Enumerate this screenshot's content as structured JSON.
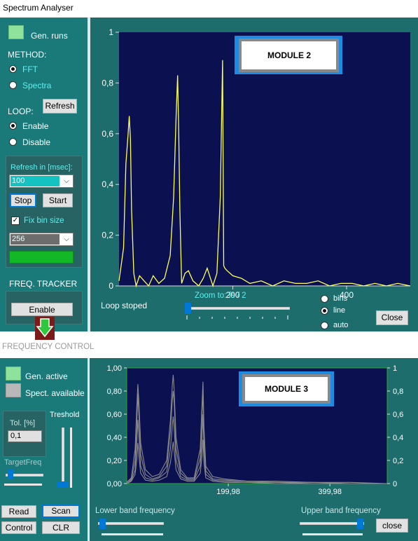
{
  "window_title": "Spectrum Analyser",
  "top": {
    "gen_runs_label": "Gen. runs",
    "method_label": "METHOD:",
    "method_options": [
      "FFT",
      "Spectra"
    ],
    "method_selected": "FFT",
    "refresh_button": "Refresh",
    "loop_label": "LOOP:",
    "loop_options": [
      "Enable",
      "Disable"
    ],
    "loop_selected": "Enable",
    "refresh_in_label": "Refresh in [msec]:",
    "refresh_value": "100",
    "stop_button": "Stop",
    "start_button": "Start",
    "fix_bin_label": "Fix bin size",
    "bin_value": "256",
    "freq_tracker_label": "FREQ. TRACKER",
    "enable_button": "Enable",
    "status_text": "Loop stoped",
    "zoom_label": "Zoom to: fs / 2",
    "zoom_level": 0,
    "view_options": [
      "bins",
      "line",
      "auto"
    ],
    "view_selected": "line",
    "close_button": "Close",
    "module_label": "MODULE 2",
    "colors": {
      "plot_bg": "#0a1050",
      "trace": "#ffff55",
      "panel": "#1a7a7a"
    }
  },
  "separator_label": "FREQUENCY CONTROL",
  "bottom": {
    "gen_active_label": "Gen. active",
    "spect_available_label": "Spect. available",
    "threshold_label": "Treshold",
    "tol_label": "Tol. [%]",
    "tol_value": "0,1",
    "target_freq_label": "TargetFreq",
    "read_button": "Read",
    "scan_button": "Scan",
    "control_button": "Control",
    "clr_button": "CLR",
    "lower_band_label": "Lower band frequency",
    "upper_band_label": "Upper band frequency",
    "close_button": "close",
    "module_label": "MODULE 3",
    "colors": {
      "plot_bg": "#0a1050",
      "trace": "#8a8a8a"
    }
  },
  "chart_data": [
    {
      "type": "line",
      "xlim": [
        0,
        512
      ],
      "ylim": [
        0,
        1
      ],
      "x_ticks": [
        "200",
        "400"
      ],
      "y_ticks": [
        "0",
        "0,2",
        "0,4",
        "0,6",
        "0,8",
        "1"
      ],
      "grid": false,
      "series": [
        {
          "x": [
            0,
            8,
            12,
            16,
            18,
            20,
            22,
            26,
            30,
            36,
            44,
            52,
            60,
            70,
            80,
            90,
            96,
            100,
            103,
            105,
            107,
            110,
            116,
            122,
            130,
            140,
            148,
            155,
            165,
            172,
            178,
            182,
            184,
            186,
            190,
            200,
            215,
            230,
            250,
            270,
            290,
            310,
            330,
            350,
            370,
            390,
            410,
            430,
            450,
            470,
            490,
            512
          ],
          "y": [
            0.02,
            0.15,
            0.48,
            0.6,
            0.67,
            0.58,
            0.3,
            0.05,
            0.0,
            0.04,
            0.02,
            0.0,
            0.04,
            0.01,
            0.03,
            0.12,
            0.35,
            0.65,
            0.83,
            0.6,
            0.3,
            0.01,
            0.05,
            0.06,
            0.02,
            0.0,
            0.03,
            0.07,
            0.0,
            0.05,
            0.35,
            0.89,
            0.08,
            0.07,
            0.06,
            0.04,
            0.03,
            0.01,
            0.02,
            0.0,
            0.02,
            0.01,
            0.01,
            0.02,
            0.0,
            0.01,
            0.01,
            0.0,
            0.01,
            0.0,
            0.01,
            0.0
          ]
        }
      ]
    },
    {
      "type": "line",
      "xlim": [
        0,
        560
      ],
      "ylim": [
        0,
        1
      ],
      "x_ticks": [
        "199,98",
        "399,98"
      ],
      "y_ticks": [
        "0,00",
        "0,20",
        "0,40",
        "0,60",
        "0,80",
        "1,00"
      ],
      "y2_ticks": [
        "0",
        "0,2",
        "0,4",
        "0,6",
        "0,8",
        "1"
      ],
      "grid": false,
      "series": [
        {
          "x": [
            0,
            10,
            18,
            22,
            24,
            26,
            30,
            40,
            55,
            70,
            86,
            94,
            98,
            100,
            102,
            106,
            116,
            130,
            145,
            158,
            162,
            164,
            166,
            170,
            185,
            210,
            260,
            320,
            400,
            480,
            560
          ],
          "y": [
            0.01,
            0.05,
            0.3,
            0.7,
            0.86,
            0.72,
            0.35,
            0.12,
            0.06,
            0.08,
            0.2,
            0.55,
            0.85,
            0.94,
            0.8,
            0.4,
            0.12,
            0.05,
            0.05,
            0.3,
            0.7,
            0.88,
            0.5,
            0.15,
            0.06,
            0.04,
            0.02,
            0.02,
            0.01,
            0.01,
            0.0
          ]
        },
        {
          "x": [
            0,
            10,
            18,
            22,
            24,
            26,
            30,
            40,
            55,
            70,
            86,
            94,
            98,
            100,
            102,
            106,
            116,
            130,
            145,
            158,
            162,
            164,
            166,
            170,
            185,
            210,
            260,
            320,
            400,
            480,
            560
          ],
          "y": [
            0.01,
            0.04,
            0.2,
            0.55,
            0.78,
            0.6,
            0.25,
            0.08,
            0.04,
            0.06,
            0.15,
            0.45,
            0.72,
            0.8,
            0.7,
            0.3,
            0.09,
            0.04,
            0.04,
            0.22,
            0.58,
            0.8,
            0.42,
            0.11,
            0.04,
            0.03,
            0.02,
            0.01,
            0.01,
            0.0,
            0.0
          ]
        },
        {
          "x": [
            0,
            10,
            18,
            22,
            24,
            26,
            30,
            40,
            55,
            70,
            86,
            94,
            98,
            100,
            102,
            106,
            116,
            130,
            145,
            158,
            162,
            164,
            166,
            170,
            185,
            210,
            260,
            320,
            400,
            480,
            560
          ],
          "y": [
            0.0,
            0.03,
            0.12,
            0.38,
            0.55,
            0.42,
            0.15,
            0.05,
            0.03,
            0.05,
            0.1,
            0.3,
            0.5,
            0.58,
            0.48,
            0.2,
            0.06,
            0.03,
            0.03,
            0.15,
            0.4,
            0.6,
            0.3,
            0.08,
            0.03,
            0.02,
            0.01,
            0.01,
            0.0,
            0.0,
            0.0
          ]
        },
        {
          "x": [
            0,
            10,
            18,
            22,
            24,
            26,
            30,
            40,
            55,
            70,
            86,
            94,
            98,
            100,
            102,
            106,
            116,
            130,
            145,
            158,
            162,
            164,
            166,
            170,
            185,
            210,
            260,
            320,
            400,
            480,
            560
          ],
          "y": [
            0.0,
            0.02,
            0.08,
            0.22,
            0.35,
            0.25,
            0.09,
            0.03,
            0.02,
            0.03,
            0.06,
            0.18,
            0.3,
            0.36,
            0.28,
            0.12,
            0.04,
            0.02,
            0.02,
            0.09,
            0.25,
            0.38,
            0.18,
            0.05,
            0.02,
            0.01,
            0.01,
            0.0,
            0.0,
            0.0,
            0.0
          ]
        }
      ]
    }
  ]
}
